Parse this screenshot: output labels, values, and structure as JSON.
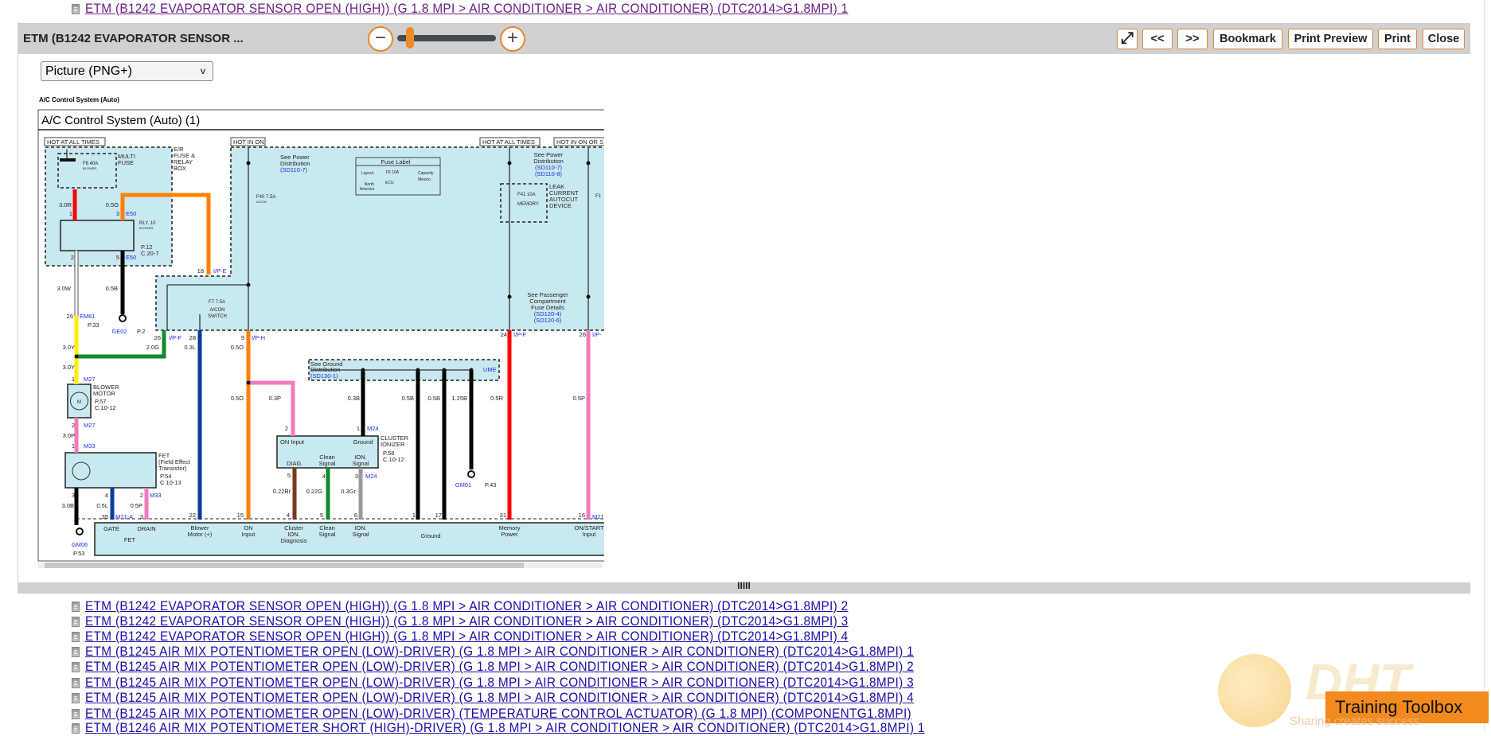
{
  "top_link": "ETM (B1242 EVAPORATOR SENSOR OPEN (HIGH)) (G 1.8 MPI > AIR CONDITIONER > AIR CONDITIONER) (DTC2014>G1.8MPI) 1",
  "toolbar": {
    "title": "ETM (B1242 EVAPORATOR SENSOR ...",
    "zoom_out": "−",
    "zoom_in": "+",
    "zoom_level_fraction": 0.1,
    "expand_icon": "⤢",
    "prev": "<<",
    "next": ">>",
    "bookmark": "Bookmark",
    "print_preview": "Print Preview",
    "print": "Print",
    "close": "Close",
    "accent": "#e8872e"
  },
  "format_select": {
    "value": "Picture (PNG+)",
    "chevron": "v"
  },
  "divider_handle": "IIIII",
  "diagram": {
    "header": "A/C Control System (Auto)",
    "title": "A/C Control System (Auto) (1)",
    "panel_color": "#c9e9f0",
    "wire_colors": {
      "R": "#ff0000",
      "O": "#ff8000",
      "W": "#ffffff",
      "B": "#000000",
      "Y": "#ffee00",
      "G": "#118a2e",
      "L": "#0b3a9e",
      "P": "#f07bbd",
      "Br": "#7a3a1c",
      "Gr": "#999999"
    },
    "labels": {
      "hot1": "HOT AT ALL TIMES",
      "hot2": "HOT IN ON",
      "hot3": "HOT AT ALL TIMES",
      "hot4": "HOT IN ON OR S",
      "mf1": "MULTI",
      "mf2": "FUSE",
      "er1": "E/R",
      "er2": "FUSE &",
      "er3": "RELAY",
      "er4": "BOX",
      "f6": "F6 40A",
      "f6b": "BLOWER",
      "w30r": "3.0R",
      "w05o": "0.5O",
      "p1": "1",
      "p3": "3",
      "e50a": "E50",
      "rly": "RLY. 10",
      "rlyb": "BLOWER",
      "p12": "P.12",
      "c207": "C.20-7",
      "p2": "2",
      "p5": "5",
      "e50b": "E50",
      "p18": "18",
      "ipe": "I/P-E",
      "sp1": "See Power",
      "sp2": "Distribution",
      "sp3": "(SD110-7)",
      "f40": "F40 7.5A",
      "f40b": "A/CON",
      "w30w": "3.0W",
      "w05b": "0.5B",
      "p26": "26",
      "em61": "EM61",
      "p33": "P.33",
      "ge02": "GE02",
      "pp2": "P.2",
      "f7": "F7 7.5A",
      "f7b": "A/CON",
      "f7c": "SWITCH",
      "p26b": "26",
      "ipf": "I/P-F",
      "p28": "28",
      "p9": "9",
      "iph": "I/P-H",
      "w30y": "3.0Y",
      "w20g": "2.0G",
      "w03l": "0.3L",
      "w05o2": "0.5O",
      "w30y2": "3.0Y",
      "m1": "1",
      "m27a": "M27",
      "bm1": "BLOWER",
      "bm2": "MOTOR",
      "p57": "P.57",
      "c1012": "C.10-12",
      "mm": "M",
      "m2": "2",
      "m27b": "M27",
      "w30p": "3.0P",
      "m1b": "1",
      "m33": "M33",
      "fet1": "FET",
      "fet2": "(Field Effect",
      "fet3": "Transistor)",
      "p54": "P.54",
      "c1013": "C.10-13",
      "w05o3": "0.5O",
      "w03p": "0.3P",
      "p2b": "2",
      "oninp": "ON Input",
      "diag": "DIAG.",
      "f3": "3",
      "f4": "4",
      "f2": "2",
      "m33b": "M33",
      "w30b": "3.0B",
      "w05l": "0.5L",
      "w05p": "0.5P",
      "p35": "35",
      "m21a": "M21-A",
      "p3b": "3",
      "p22": "22",
      "p15": "15",
      "p4": "4",
      "p5b": "5",
      "w022br": "0.22Br",
      "gate": "GATE",
      "drain": "DRAIN",
      "fetb": "FET",
      "bl1": "Blower",
      "bl2": "Motor (+)",
      "on1": "ON",
      "on2": "Input",
      "cl1": "Cluster",
      "cl2": "ION.",
      "cl3": "Diagnosis",
      "gm06": "GM06",
      "p53": "P.53",
      "p24": "24",
      "ipf2": "I/P-F",
      "p26c": "26",
      "ipx": "I/P-",
      "sg1": "See Ground",
      "sg2": "Distribution",
      "sg3": "(SD130-1)",
      "ume": "UME",
      "w03b": "0.3B",
      "w05b2": "0.5B",
      "w05b3": "0.5B",
      "w125b": "1.25B",
      "w05r": "0.5R",
      "w05p2": "0.5P",
      "p1c": "1",
      "m24": "M24",
      "gnd": "Ground",
      "ci1": "CLUSTER",
      "ci2": "IONIZER",
      "p58": "P.58",
      "c1012b": "C.10-12",
      "cs1": "Clean",
      "cs2": "Signal",
      "is1": "ION.",
      "is2": "Signal",
      "p4b": "4",
      "p3c": "3",
      "m24b": "M24",
      "w022g": "0.22G",
      "w03gr": "0.3Gr",
      "gm01": "GM01",
      "p43": "P.43",
      "q5": "5",
      "q6": "6",
      "q1": "1",
      "q17": "17",
      "q31": "31",
      "q16": "16",
      "m21": "M21",
      "cs3": "Clean",
      "cs4": "Signal",
      "is3": "ION.",
      "is4": "Signal",
      "gnd2": "Ground",
      "mp1": "Memory",
      "mp2": "Power",
      "os1": "ON/START",
      "os2": "Input",
      "fl": "Fuse Label",
      "fl_layout": "Layout",
      "fl_na1": "North",
      "fl_na2": "America",
      "fl_cap": "Capacity",
      "fl_mex": "Mexico",
      "fl_f5": "F5 10A",
      "fl_ecu": "ECU",
      "sp4": "See Power",
      "sp5": "Distribution",
      "sp6": "(SD110-7)",
      "sp7": "(SD110-8)",
      "f41": "F41 10A",
      "f41b": "MEMORY",
      "lk1": "LEAK",
      "lk2": "CURRENT",
      "lk3": "AUTOCUT",
      "lk4": "DEVICE",
      "spc1": "See Passenger",
      "spc2": "Compartment",
      "spc3": "Fuse Details",
      "spc4": "(SD120-4)",
      "spc5": "(SD120-6)",
      "f1x": "F1"
    }
  },
  "links": [
    "ETM (B1242 EVAPORATOR SENSOR OPEN (HIGH)) (G 1.8 MPI > AIR CONDITIONER > AIR CONDITIONER) (DTC2014>G1.8MPI) 2",
    "ETM (B1242 EVAPORATOR SENSOR OPEN (HIGH)) (G 1.8 MPI > AIR CONDITIONER > AIR CONDITIONER) (DTC2014>G1.8MPI) 3",
    "ETM (B1242 EVAPORATOR SENSOR OPEN (HIGH)) (G 1.8 MPI > AIR CONDITIONER > AIR CONDITIONER) (DTC2014>G1.8MPI) 4",
    "ETM (B1245 AIR MIX POTENTIOMETER OPEN (LOW)-DRIVER) (G 1.8 MPI > AIR CONDITIONER > AIR CONDITIONER) (DTC2014>G1.8MPI) 1",
    "ETM (B1245 AIR MIX POTENTIOMETER OPEN (LOW)-DRIVER) (G 1.8 MPI > AIR CONDITIONER > AIR CONDITIONER) (DTC2014>G1.8MPI) 2",
    "ETM (B1245 AIR MIX POTENTIOMETER OPEN (LOW)-DRIVER) (G 1.8 MPI > AIR CONDITIONER > AIR CONDITIONER) (DTC2014>G1.8MPI) 3",
    "ETM (B1245 AIR MIX POTENTIOMETER OPEN (LOW)-DRIVER) (G 1.8 MPI > AIR CONDITIONER > AIR CONDITIONER) (DTC2014>G1.8MPI) 4",
    "ETM (B1245 AIR MIX POTENTIOMETER OPEN (LOW)-DRIVER) (TEMPERATURE CONTROL ACTUATOR) (G 1.8 MPI) (COMPONENTG1.8MPI)",
    "ETM (B1246 AIR MIX POTENTIOMETER SHORT (HIGH)-DRIVER) (G 1.8 MPI > AIR CONDITIONER > AIR CONDITIONER) (DTC2014>G1.8MPI) 1"
  ],
  "watermark": {
    "logo": "DHT",
    "badge": "Training Toolbox",
    "slogan": "Sharing creates success"
  }
}
